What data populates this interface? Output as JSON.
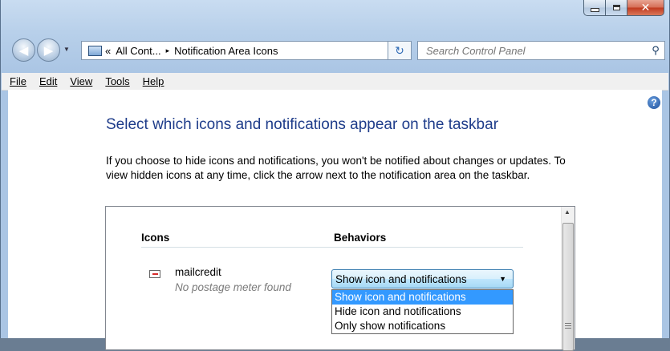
{
  "window": {
    "title": ""
  },
  "address": {
    "segments": [
      "«",
      "All Cont...",
      "▸",
      "Notification Area Icons"
    ]
  },
  "search": {
    "placeholder": "Search Control Panel"
  },
  "menu": [
    "File",
    "Edit",
    "View",
    "Tools",
    "Help"
  ],
  "page": {
    "title": "Select which icons and notifications appear on the taskbar",
    "description": "If you choose to hide icons and notifications, you won't be notified about changes or updates. To view hidden icons at any time, click the arrow next to the notification area on the taskbar."
  },
  "table": {
    "headers": {
      "icons": "Icons",
      "behaviors": "Behaviors"
    },
    "rows": [
      {
        "name": "mailcredit",
        "description": "No postage meter found",
        "behavior": "Show icon and notifications"
      }
    ]
  },
  "dropdown_options": [
    "Show icon and notifications",
    "Hide icon and notifications",
    "Only show notifications"
  ],
  "dropdown_selected_index": 0,
  "icons": {
    "back": "back-arrow-icon",
    "forward": "forward-arrow-icon",
    "refresh": "refresh-icon",
    "search": "search-icon",
    "help": "help-icon",
    "control_panel": "control-panel-icon",
    "app": "mailcredit-app-icon"
  },
  "colors": {
    "title_blue": "#1e3c8a",
    "selection": "#3399ff",
    "close_red": "#c0391f"
  }
}
